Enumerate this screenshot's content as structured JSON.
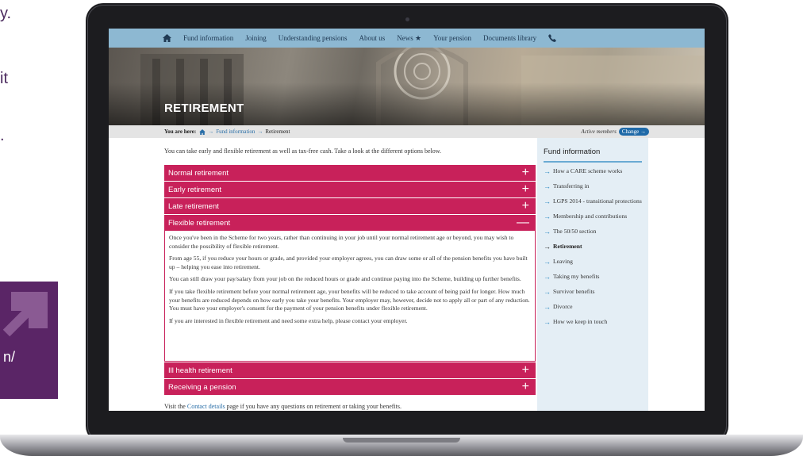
{
  "side": {
    "line1": "y.",
    "line2": "it",
    "line3": ".",
    "promo_text": "n/"
  },
  "colors": {
    "nav": "#8db8d2",
    "accordion": "#c8215a",
    "link": "#2a6fa8",
    "sidebar_bg": "#e4eef5",
    "promo": "#5a2566"
  },
  "nav": {
    "home_icon": "home-icon",
    "items": [
      {
        "label": "Fund information"
      },
      {
        "label": "Joining"
      },
      {
        "label": "Understanding pensions"
      },
      {
        "label": "About us"
      },
      {
        "label": "News ★"
      },
      {
        "label": "Your pension"
      },
      {
        "label": "Documents library"
      }
    ],
    "phone_icon": "phone-icon"
  },
  "hero": {
    "title": "RETIREMENT"
  },
  "breadcrumb": {
    "prefix": "You are here:",
    "home_icon": "home-icon",
    "items": [
      "Fund information",
      "Retirement"
    ],
    "members_label": "Active members",
    "change_label": "Change →"
  },
  "main": {
    "intro": "You can take early and flexible retirement as well as tax-free cash. Take a look at the different options below.",
    "accordion": [
      {
        "label": "Normal retirement",
        "toggle": "+"
      },
      {
        "label": "Early retirement",
        "toggle": "+"
      },
      {
        "label": "Late retirement",
        "toggle": "+"
      },
      {
        "label": "Flexible retirement",
        "toggle": "—"
      },
      {
        "label": "Ill health retirement",
        "toggle": "+"
      },
      {
        "label": "Receiving a pension",
        "toggle": "+"
      }
    ],
    "flexible_paragraphs": [
      "Once you've been in the Scheme for two years, rather than continuing in your job until your normal retirement age or beyond, you may wish to consider the possibility of flexible retirement.",
      "From age 55, if you reduce your hours or grade, and provided your employer agrees, you can draw some or all of the pension benefits you have built up – helping you ease into retirement.",
      "You can still draw your pay/salary from your job on the reduced hours or grade and continue paying into the Scheme, building up further benefits.",
      "If you take flexible retirement before your normal retirement age, your benefits will be reduced to take account of being paid for longer. How much your benefits are reduced depends on how early you take your benefits. Your employer may, however, decide not to apply all or part of any reduction. You must have your employer's consent for the payment of your pension benefits under flexible retirement.",
      "If you are interested in flexible retirement and need some extra help, please contact your employer."
    ],
    "footer_prefix": "Visit the ",
    "footer_link": "Contact details",
    "footer_suffix": " page if you have any questions on retirement or taking your benefits."
  },
  "sidebar": {
    "title": "Fund information",
    "items": [
      {
        "label": "How a CARE scheme works"
      },
      {
        "label": "Transferring in"
      },
      {
        "label": "LGPS 2014 - transitional protections"
      },
      {
        "label": "Membership and contributions"
      },
      {
        "label": "The 50/50 section"
      },
      {
        "label": "Retirement"
      },
      {
        "label": "Leaving"
      },
      {
        "label": "Taking my benefits"
      },
      {
        "label": "Survivor benefits"
      },
      {
        "label": "Divorce"
      },
      {
        "label": "How we keep in touch"
      }
    ]
  }
}
